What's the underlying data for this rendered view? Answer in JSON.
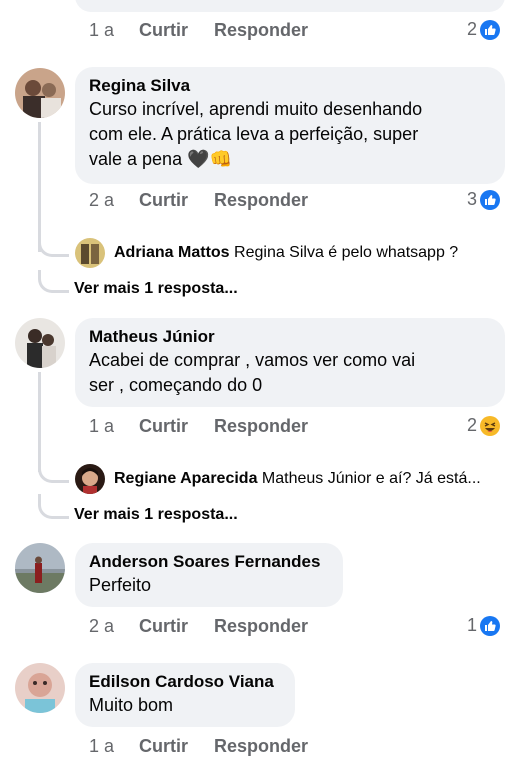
{
  "actions": {
    "like": "Curtir",
    "reply": "Responder"
  },
  "top": {
    "age": "1 a",
    "reaction_count": "2",
    "reaction": "like-icon"
  },
  "comments": [
    {
      "author": "Regina Silva",
      "lines": [
        "Curso incrível, aprendi muito desenhando",
        "com ele. A prática leva a perfeição, super",
        "vale a pena"
      ],
      "emoji": "🖤👊",
      "age": "2 a",
      "reaction_count": "3",
      "reaction": "like-icon",
      "reply": {
        "author": "Adriana Mattos",
        "text": "Regina Silva é pelo whatsapp ?"
      },
      "more": "Ver mais 1 resposta..."
    },
    {
      "author": "Matheus Júnior",
      "lines": [
        "Acabei de comprar , vamos ver como vai",
        "ser , começando do 0"
      ],
      "age": "1 a",
      "reaction_count": "2",
      "reaction": "haha-icon",
      "reply": {
        "author": "Regiane Aparecida",
        "text": "Matheus Júnior e aí? Já está..."
      },
      "more": "Ver mais 1 resposta..."
    },
    {
      "author": "Anderson Soares Fernandes",
      "lines": [
        "Perfeito"
      ],
      "age": "2 a",
      "reaction_count": "1",
      "reaction": "like-icon"
    },
    {
      "author": "Edilson Cardoso Viana",
      "lines": [
        "Muito bom"
      ],
      "age": "1 a"
    }
  ]
}
